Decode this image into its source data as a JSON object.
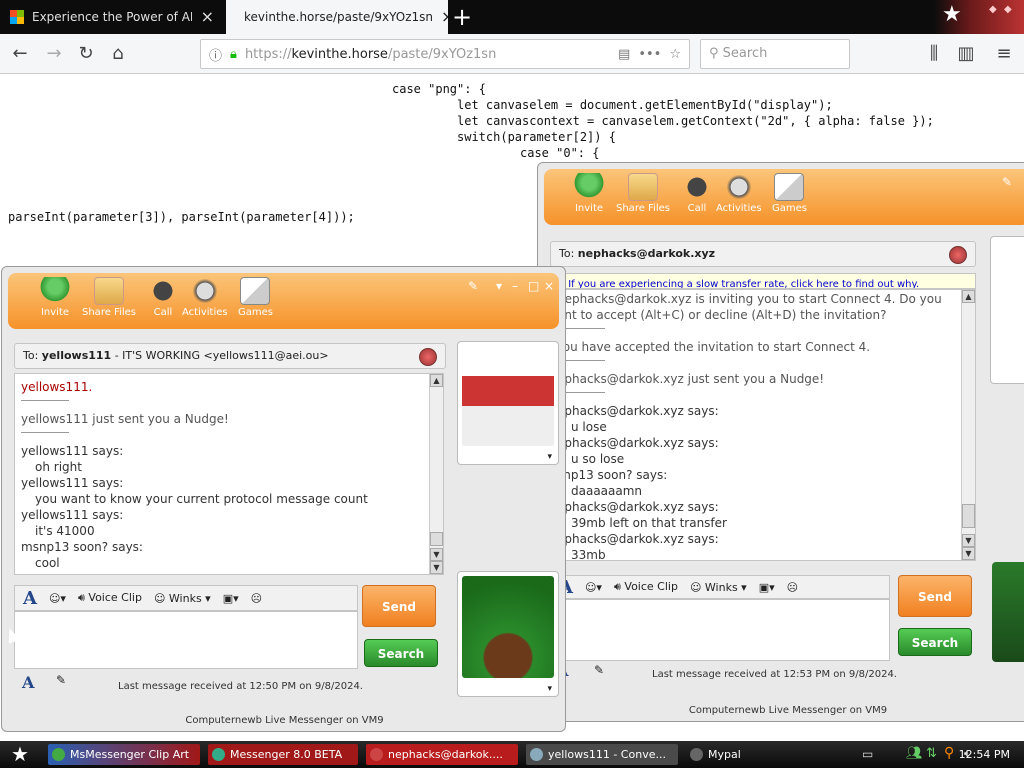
{
  "browser": {
    "tabs": [
      {
        "title": "Experience the Power of AI with W",
        "active": false
      },
      {
        "title": "kevinthe.horse/paste/9xYOz1sn",
        "active": true
      }
    ],
    "url_scheme": "https://",
    "url_host": "kevinthe.horse",
    "url_path": "/paste/9xYOz1sn",
    "search_placeholder": "Search"
  },
  "page_code": {
    "lines": [
      "case \"png\": {",
      "let canvaselem = document.getElementById(\"display\");",
      "let canvascontext = canvaselem.getContext(\"2d\", { alpha: false });",
      "switch(parameter[2]) {",
      "case \"0\": {",
      "parseInt(parameter[3]), parseInt(parameter[4]));"
    ]
  },
  "toolbar": {
    "invite": "Invite",
    "share": "Share Files",
    "call": "Call",
    "activities": "Activities",
    "games": "Games"
  },
  "left_window": {
    "to_label": "To:",
    "to_name": "yellows111",
    "to_rest": " - IT'S WORKING <yellows111@aei.ou>",
    "messages": [
      "yellows111.",
      "yellows111 just sent you a Nudge!",
      "yellows111 says:",
      "oh right",
      "yellows111 says:",
      "you want to know your current protocol message count",
      "yellows111 says:",
      "it's 41000",
      "msnp13 soon? says:",
      "cool"
    ],
    "status": "Last message received at 12:50 PM on 9/8/2024.",
    "footer": "Computernewb Live Messenger on VM9"
  },
  "right_window": {
    "to_label": "To:",
    "to_name": "nephacks@darkok.xyz",
    "info_bar": "If you are experiencing a slow transfer rate, click here to find out why.",
    "messages": [
      "nephacks@darkok.xyz is inviting you to start Connect 4. Do you",
      "ant to accept (Alt+C) or decline (Alt+D) the invitation?",
      "You have accepted the invitation to start Connect 4.",
      "ephacks@darkok.xyz just sent you a Nudge!",
      "ephacks@darkok.xyz says:",
      "u lose",
      "ephacks@darkok.xyz says:",
      "u so lose",
      "snp13 soon? says:",
      "daaaaaamn",
      "ephacks@darkok.xyz says:",
      "39mb left on that transfer",
      "ephacks@darkok.xyz says:",
      "33mb"
    ],
    "status": "Last message received at 12:53 PM on 9/8/2024.",
    "footer": "Computernewb Live Messenger on VM9"
  },
  "compose": {
    "voice_clip": "Voice Clip",
    "winks": "Winks",
    "send": "Send",
    "search": "Search"
  },
  "taskbar": {
    "items": [
      "MsMessenger Clip Art",
      "Messenger 8.0 BETA",
      "nephacks@darkok....",
      "yellows111 - Conve...",
      "Mypal"
    ],
    "clock": "12:54 PM"
  },
  "colors": {
    "toolbar_orange": "#f6922a",
    "send_orange": "#f08020",
    "search_green": "#2a8a2a",
    "taskbar_red": "#a01818"
  }
}
